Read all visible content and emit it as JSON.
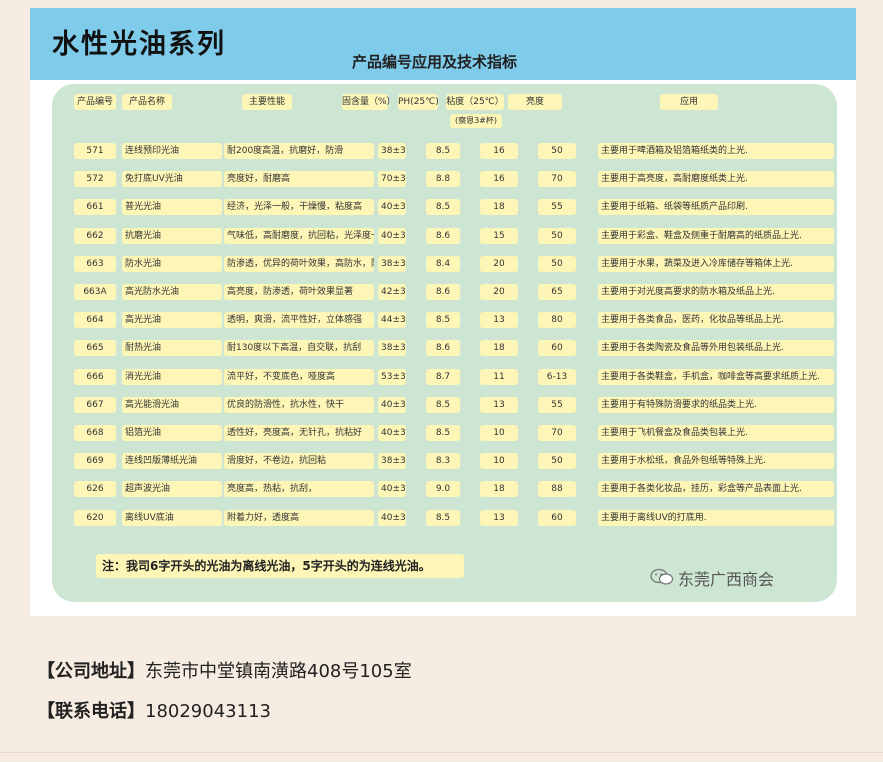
{
  "banner": {
    "title": "水性光油系列",
    "subtitle": "产品编号应用及技术指标"
  },
  "table": {
    "headers": {
      "code": "产品编号",
      "name": "产品名称",
      "perf": "主要性能",
      "solid": "固含量（%）",
      "ph": "PH(25℃)",
      "visc": "粘度（25℃）",
      "visc_sub": "(察恩3#杯)",
      "gloss": "亮度",
      "app": "应用"
    },
    "rows": [
      {
        "code": "571",
        "name": "连线预印光油",
        "perf": "耐200度高温，抗磨好，防滑",
        "solid": "38±3",
        "ph": "8.5",
        "visc": "16",
        "gloss": "50",
        "app": "主要用于啤酒箱及铝箔箱纸类的上光."
      },
      {
        "code": "572",
        "name": "免打底UV光油",
        "perf": "亮度好，耐磨高",
        "solid": "70±3",
        "ph": "8.8",
        "visc": "16",
        "gloss": "70",
        "app": "主要用于高亮度，高耐磨度纸类上光."
      },
      {
        "code": "661",
        "name": "普光光油",
        "perf": "经济，光泽一般，干燥慢，粘度高",
        "solid": "40±3",
        "ph": "8.5",
        "visc": "18",
        "gloss": "55",
        "app": "主要用于纸箱、纸袋等纸质产品印刷."
      },
      {
        "code": "662",
        "name": "抗磨光油",
        "perf": "气味低，高耐磨度，抗回粘，光泽度一般",
        "solid": "40±3",
        "ph": "8.6",
        "visc": "15",
        "gloss": "50",
        "app": "主要用于彩盒、鞋盒及侧重于耐磨高的纸质品上光."
      },
      {
        "code": "663",
        "name": "防水光油",
        "perf": "防渗透，优异的荷叶效果，高防水，防潮",
        "solid": "38±3",
        "ph": "8.4",
        "visc": "20",
        "gloss": "50",
        "app": "主要用于水果，蔬菜及进入冷库储存等箱体上光."
      },
      {
        "code": "663A",
        "name": "高光防水光油",
        "perf": "高亮度，防渗透，荷叶效果显著",
        "solid": "42±3",
        "ph": "8.6",
        "visc": "20",
        "gloss": "65",
        "app": "主要用于对光度高要求的防水箱及纸品上光."
      },
      {
        "code": "664",
        "name": "高光光油",
        "perf": "透明，爽滑，流平性好，立体感强",
        "solid": "44±3",
        "ph": "8.5",
        "visc": "13",
        "gloss": "80",
        "app": "主要用于各类食品，医药，化妆品等纸品上光."
      },
      {
        "code": "665",
        "name": "耐热光油",
        "perf": "耐130度以下高温，自交联，抗刮",
        "solid": "38±3",
        "ph": "8.6",
        "visc": "18",
        "gloss": "60",
        "app": "主要用于各类陶瓷及食品等外用包装纸品上光."
      },
      {
        "code": "666",
        "name": "消光光油",
        "perf": "流平好，不变底色，哑度高",
        "solid": "53±3",
        "ph": "8.7",
        "visc": "11",
        "gloss": "6-13",
        "app": "主要用于各类鞋盒，手机盒，咖啡盒等高要求纸质上光."
      },
      {
        "code": "667",
        "name": "高光能滑光油",
        "perf": "优良的防滑性，抗水性，快干",
        "solid": "40±3",
        "ph": "8.5",
        "visc": "13",
        "gloss": "55",
        "app": "主要用于有特殊防滑要求的纸品类上光."
      },
      {
        "code": "668",
        "name": "铝箔光油",
        "perf": "透性好，亮度高，无针孔，抗粘好",
        "solid": "40±3",
        "ph": "8.5",
        "visc": "10",
        "gloss": "70",
        "app": "主要用于飞机餐盒及食品类包装上光."
      },
      {
        "code": "669",
        "name": "连线凹版薄纸光油",
        "perf": "滑度好，不卷边，抗回粘",
        "solid": "38±3",
        "ph": "8.3",
        "visc": "10",
        "gloss": "50",
        "app": "主要用于水松纸，食品外包纸等特殊上光."
      },
      {
        "code": "626",
        "name": "超声波光油",
        "perf": "亮度高，热粘，抗刮，",
        "solid": "40±3",
        "ph": "9.0",
        "visc": "18",
        "gloss": "88",
        "app": "主要用于各类化妆品，挂历，彩盒等产品表面上光."
      },
      {
        "code": "620",
        "name": "离线UV底油",
        "perf": "附着力好，透度高",
        "solid": "40±3",
        "ph": "8.5",
        "visc": "13",
        "gloss": "60",
        "app": "主要用于离线UV的打底用."
      }
    ],
    "note": "注：我司6字开头的光油为离线光油，5字开头的为连线光油。"
  },
  "watermark": {
    "icon": "wechat-icon",
    "text": "东莞广西商会"
  },
  "contact": {
    "address_label": "【公司地址】",
    "address_value": "东莞市中堂镇南潢路408号105室",
    "phone_label": "【联系电话】",
    "phone_value": "18029043113"
  },
  "colors": {
    "banner": "#7fcbea",
    "panel": "#cde6d4",
    "cell": "#fdf6b7",
    "page": "#f7ece1"
  }
}
